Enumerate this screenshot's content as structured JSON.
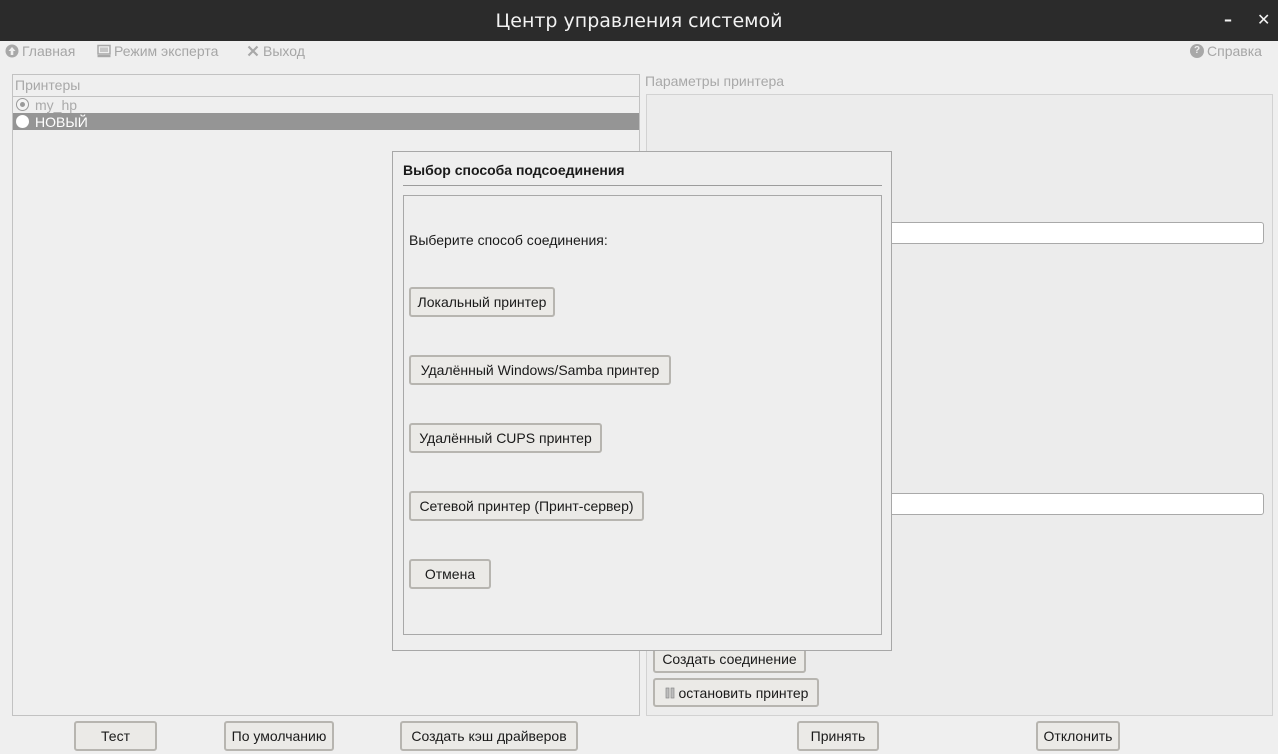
{
  "window": {
    "title": "Центр управления системой",
    "minimize_glyph": "–",
    "close_glyph": "✕"
  },
  "menubar": {
    "home": {
      "label": "Главная",
      "icon": "arrow-up-circle-icon"
    },
    "expert": {
      "label": "Режим эксперта",
      "icon": "monitor-icon"
    },
    "exit": {
      "label": "Выход",
      "icon": "close-x-icon"
    },
    "help": {
      "label": "Справка",
      "icon": "question-circle-icon"
    }
  },
  "printers": {
    "title": "Принтеры",
    "items": [
      {
        "name": "my_hp",
        "checked": true,
        "state": "disabled"
      },
      {
        "name": "НОВЫЙ",
        "checked": false,
        "state": "selected"
      }
    ]
  },
  "params": {
    "title": "Параметры принтера",
    "create_connection_label": "Создать соединение",
    "stop_printer_label": "остановить принтер",
    "stop_printer_icon": "pause-icon"
  },
  "dialog": {
    "title": "Выбор способа подсоединения",
    "prompt": "Выберите способ соединения:",
    "options": [
      "Локальный принтер",
      "Удалённый Windows/Samba принтер",
      "Удалённый CUPS принтер",
      "Сетевой принтер (Принт-сервер)"
    ],
    "cancel_label": "Отмена"
  },
  "bottom": {
    "test": "Тест",
    "default": "По умолчанию",
    "create_cache": "Создать кэш драйверов",
    "accept": "Принять",
    "decline": "Отклонить"
  },
  "colors": {
    "titlebar_bg": "#2b2b2b",
    "window_bg": "#efefef",
    "selection_bg": "#959595",
    "disabled_text": "#a8a8a8"
  }
}
